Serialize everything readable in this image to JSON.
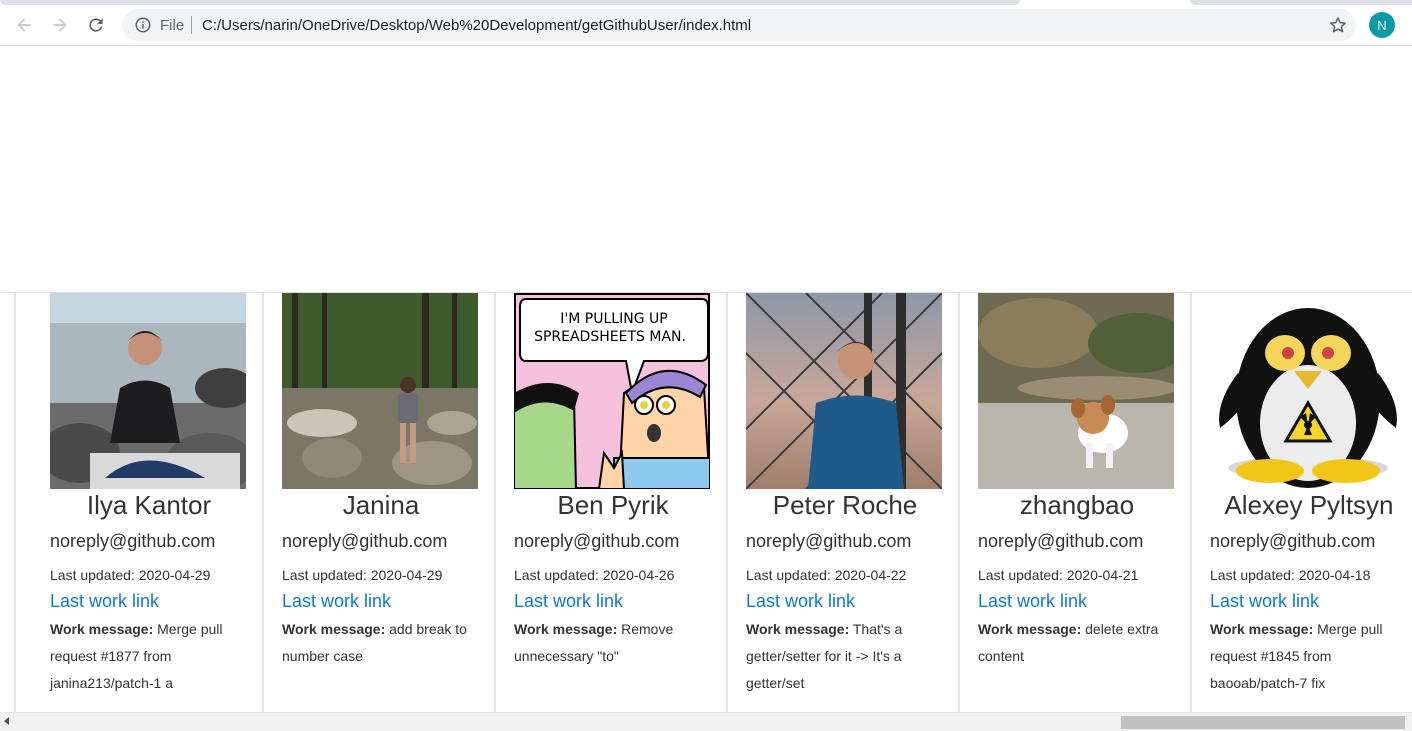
{
  "browser": {
    "scheme_label": "File",
    "url": "C:/Users/narin/OneDrive/Desktop/Web%20Development/getGithubUser/index.html",
    "profile_initial": "N",
    "profile_color": "#0a9aa8"
  },
  "labels": {
    "work_message": "Work message:",
    "link_text": "Last work link"
  },
  "users": [
    {
      "name": "Ilya Kantor",
      "email": "noreply@github.com",
      "updated": "Last updated: 2020-04-29",
      "link": "Last work link",
      "message": "Merge pull request #1877 from janina213/patch-1 a"
    },
    {
      "name": "Janina",
      "email": "noreply@github.com",
      "updated": "Last updated: 2020-04-29",
      "link": "Last work link",
      "message": "add break to number case"
    },
    {
      "name": "Ben Pyrik",
      "email": "noreply@github.com",
      "updated": "Last updated: 2020-04-26",
      "link": "Last work link",
      "message": "Remove unnecessary \"to\""
    },
    {
      "name": "Peter Roche",
      "email": "noreply@github.com",
      "updated": "Last updated: 2020-04-22",
      "link": "Last work link",
      "message": "That's a getter/setter for it -> It's a getter/set"
    },
    {
      "name": "zhangbao",
      "email": "noreply@github.com",
      "updated": "Last updated: 2020-04-21",
      "link": "Last work link",
      "message": "delete extra content"
    },
    {
      "name": "Alexey Pyltsyn",
      "email": "noreply@github.com",
      "updated": "Last updated: 2020-04-18",
      "link": "Last work link",
      "message": "Merge pull request #1845 from baooab/patch-7 fix"
    }
  ],
  "comic": {
    "line1": "I'M PULLING UP",
    "line2": "SPREADSHEETS MAN."
  },
  "colors": {
    "link": "#0b7ad1"
  }
}
